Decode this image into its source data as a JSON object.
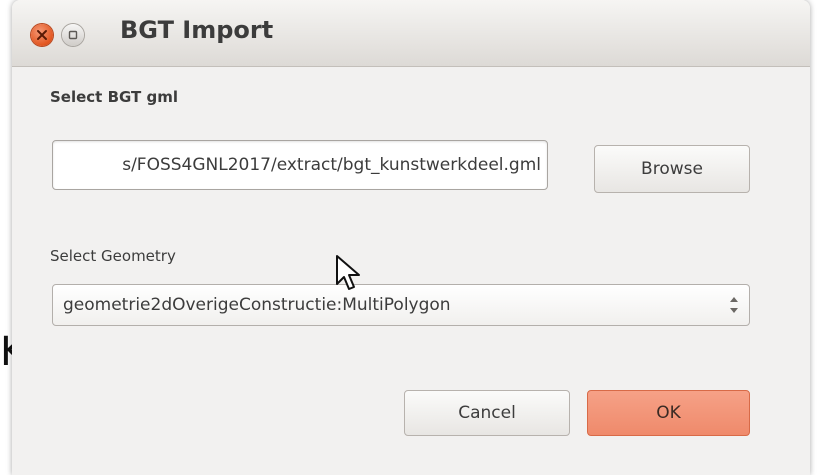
{
  "background_fragment": "K",
  "window": {
    "title": "BGT Import"
  },
  "gml_section": {
    "label": "Select BGT gml",
    "path_value": "s/FOSS4GNL2017/extract/bgt_kunstwerkdeel.gml",
    "browse_label": "Browse"
  },
  "geometry_section": {
    "label": "Select Geometry",
    "selected_value": "geometrie2dOverigeConstructie:MultiPolygon"
  },
  "buttons": {
    "cancel_label": "Cancel",
    "ok_label": "OK"
  },
  "colors": {
    "close_button": "#e2551f",
    "ok_button": "#ef8a6b",
    "dialog_background": "#f2f1f0"
  },
  "icons": [
    "close-icon",
    "maximize-icon",
    "spin-arrows-icon",
    "mouse-pointer-icon"
  ]
}
